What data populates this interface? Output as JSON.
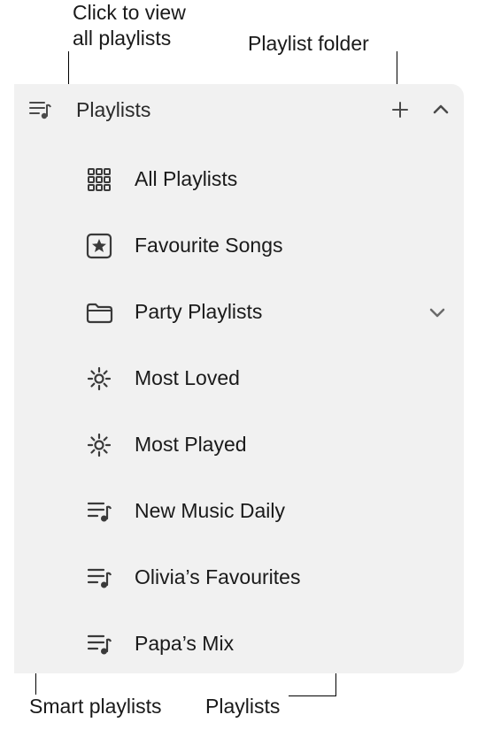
{
  "callouts": {
    "top_left": "Click to view\nall playlists",
    "top_right": "Playlist folder",
    "bottom_left": "Smart playlists",
    "bottom_right": "Playlists"
  },
  "header": {
    "title": "Playlists"
  },
  "items": {
    "all": "All Playlists",
    "fav": "Favourite Songs",
    "folder": "Party Playlists",
    "smart1": "Most Loved",
    "smart2": "Most Played",
    "pl1": "New Music Daily",
    "pl2": "Olivia’s Favourites",
    "pl3": "Papa’s Mix"
  }
}
